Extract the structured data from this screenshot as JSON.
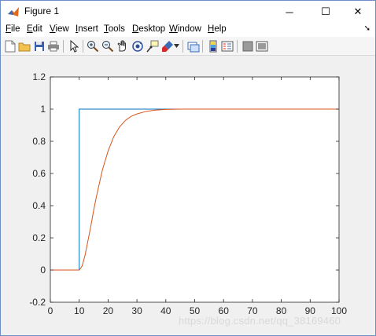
{
  "window": {
    "title": "Figure 1",
    "controls": {
      "minimize": "─",
      "maximize": "☐",
      "close": "✕"
    }
  },
  "menubar": {
    "items": [
      {
        "label": "File"
      },
      {
        "label": "Edit"
      },
      {
        "label": "View"
      },
      {
        "label": "Insert"
      },
      {
        "label": "Tools"
      },
      {
        "label": "Desktop"
      },
      {
        "label": "Window"
      },
      {
        "label": "Help"
      }
    ],
    "overflow_icon": "arrow-icon"
  },
  "toolbar": {
    "icons": [
      "new-figure-icon",
      "open-file-icon",
      "save-icon",
      "print-icon",
      "edit-plot-arrow-icon",
      "zoom-in-icon",
      "zoom-out-icon",
      "pan-hand-icon",
      "rotate-3d-icon",
      "data-cursor-icon",
      "brush-icon",
      "brush-dropdown-icon",
      "link-plot-icon",
      "insert-colorbar-icon",
      "insert-legend-icon",
      "hide-plot-tools-icon",
      "show-plot-tools-icon"
    ]
  },
  "chart_data": {
    "type": "line",
    "title": "",
    "xlabel": "",
    "ylabel": "",
    "xlim": [
      0,
      100
    ],
    "ylim": [
      -0.2,
      1.2
    ],
    "xticks": [
      0,
      10,
      20,
      30,
      40,
      50,
      60,
      70,
      80,
      90,
      100
    ],
    "yticks": [
      -0.2,
      0,
      0.2,
      0.4,
      0.6,
      0.8,
      1,
      1.2
    ],
    "xtick_labels": [
      "0",
      "10",
      "20",
      "30",
      "40",
      "50",
      "60",
      "70",
      "80",
      "90",
      "100"
    ],
    "ytick_labels": [
      "-0.2",
      "0",
      "0.2",
      "0.4",
      "0.6",
      "0.8",
      "1",
      "1.2"
    ],
    "grid": false,
    "legend": "none",
    "series": [
      {
        "color": "#0072bd",
        "x": [
          0,
          10,
          10,
          100
        ],
        "y": [
          0,
          0,
          1,
          1
        ]
      },
      {
        "color": "#d95319",
        "x": [
          0,
          10,
          11,
          12,
          13,
          14,
          15,
          16,
          17,
          18,
          19,
          20,
          22,
          24,
          26,
          28,
          30,
          33,
          36,
          40,
          45,
          50,
          60,
          80,
          100
        ],
        "y": [
          0,
          0,
          0.025,
          0.09,
          0.18,
          0.27,
          0.37,
          0.46,
          0.54,
          0.62,
          0.68,
          0.74,
          0.83,
          0.89,
          0.93,
          0.955,
          0.97,
          0.985,
          0.993,
          0.998,
          1,
          1,
          1,
          1,
          1
        ]
      }
    ]
  },
  "watermark": "https://blog.csdn.net/qq_38169460"
}
